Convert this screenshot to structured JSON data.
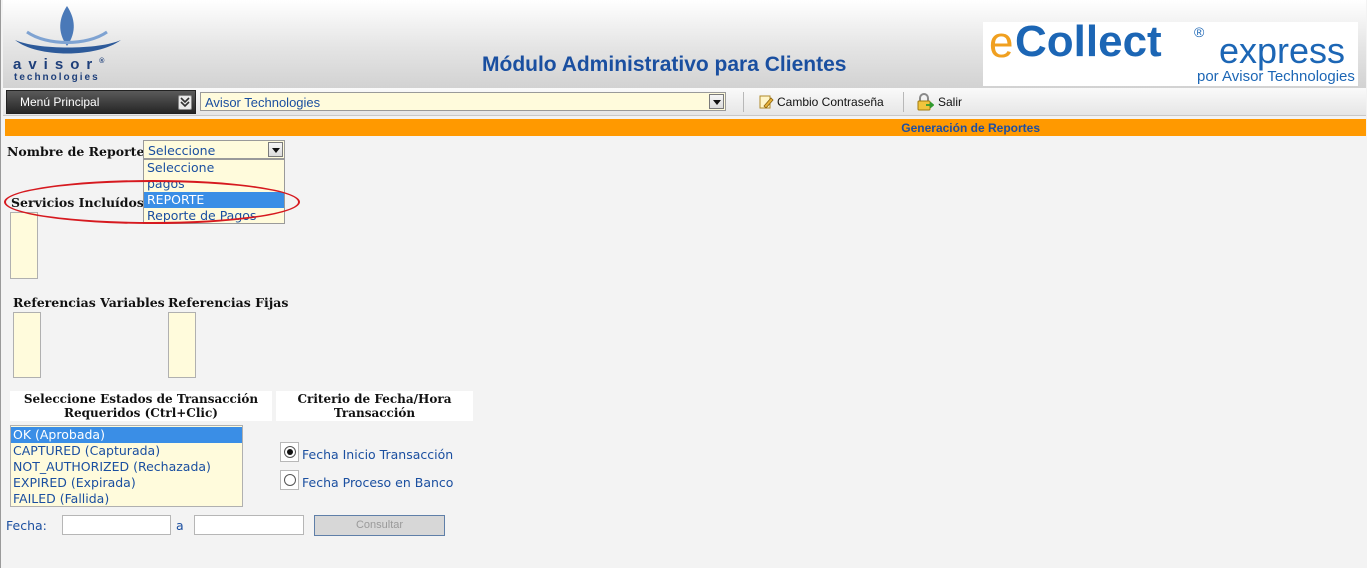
{
  "header": {
    "logo_text": "avisor",
    "logo_reg": "®",
    "logo_sub": "technologies",
    "app_title": "Módulo Administrativo para Clientes",
    "brand_e": "e",
    "brand_collect": "Collect",
    "brand_reg": "®",
    "brand_express": "express",
    "brand_by": "por Avisor Technologies"
  },
  "toolbar": {
    "menu_label": "Menú Principal",
    "company_value": "Avisor Technologies",
    "password_label": "Cambio Contraseña",
    "exit_label": "Salir"
  },
  "section": {
    "title": "Generación de Reportes"
  },
  "form": {
    "report_label": "Nombre de Reporte:",
    "report_selected": "Seleccione",
    "report_options": [
      "Seleccione",
      "pagos",
      "REPORTE",
      "Reporte de Pagos"
    ],
    "report_highlighted_index": 2,
    "services_label": "Servicios Incluídos e",
    "var_refs_label": "Referencias Variables",
    "fixed_refs_label": "Referencias Fijas",
    "states_header": "Seleccione Estados de Transacción Requeridos (Ctrl+Clic)",
    "states": [
      "OK (Aprobada)",
      "CAPTURED (Capturada)",
      "NOT_AUTHORIZED (Rechazada)",
      "EXPIRED (Expirada)",
      "FAILED (Fallida)"
    ],
    "states_selected_index": 0,
    "criteria_header": "Criterio de Fecha/Hora Transacción",
    "radio_start": "Fecha Inicio Transacción",
    "radio_bank": "Fecha Proceso en Banco",
    "radio_selected": "start",
    "date_label": "Fecha:",
    "date_sep": "a",
    "date_from": "",
    "date_to": "",
    "consult_label": "Consultar"
  },
  "colors": {
    "section_bar": "#ff9900",
    "title_blue": "#1a4fa0",
    "annotation_red": "#d6191f",
    "selection_blue": "#3a8ee6"
  }
}
